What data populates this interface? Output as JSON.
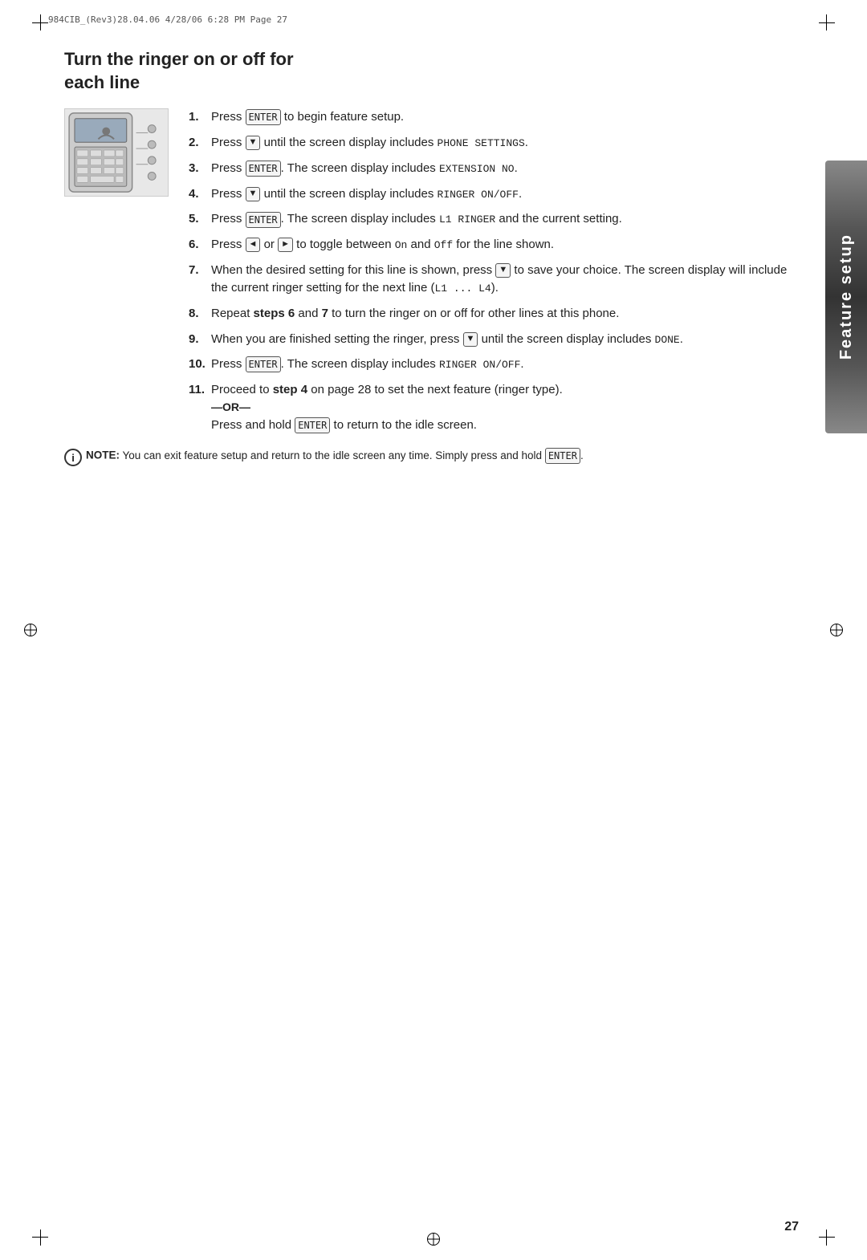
{
  "header": {
    "label": "984CIB_(Rev3)28.04.06  4/28/06  6:28 PM  Page 27"
  },
  "sidebar": {
    "text": "Feature setup"
  },
  "title": {
    "line1": "Turn the ringer on or off for",
    "line2": "each line"
  },
  "steps": [
    {
      "num": "1.",
      "text_parts": [
        {
          "type": "text",
          "value": "Press "
        },
        {
          "type": "key",
          "value": "ENTER"
        },
        {
          "type": "text",
          "value": " to begin feature setup."
        }
      ]
    },
    {
      "num": "2.",
      "text_parts": [
        {
          "type": "text",
          "value": "Press "
        },
        {
          "type": "arrow",
          "value": "▼"
        },
        {
          "type": "text",
          "value": " until the screen display includes "
        },
        {
          "type": "mono",
          "value": "PHONE SETTINGS"
        },
        {
          "type": "text",
          "value": "."
        }
      ]
    },
    {
      "num": "3.",
      "text_parts": [
        {
          "type": "text",
          "value": "Press "
        },
        {
          "type": "key",
          "value": "ENTER"
        },
        {
          "type": "text",
          "value": ". The screen display includes "
        },
        {
          "type": "mono",
          "value": "EXTENSION NO"
        },
        {
          "type": "text",
          "value": "."
        }
      ]
    },
    {
      "num": "4.",
      "text_parts": [
        {
          "type": "text",
          "value": "Press "
        },
        {
          "type": "arrow",
          "value": "▼"
        },
        {
          "type": "text",
          "value": " until the screen display includes "
        },
        {
          "type": "mono",
          "value": "RINGER ON/OFF"
        },
        {
          "type": "text",
          "value": "."
        }
      ]
    },
    {
      "num": "5.",
      "text_parts": [
        {
          "type": "text",
          "value": "Press "
        },
        {
          "type": "key",
          "value": "ENTER"
        },
        {
          "type": "text",
          "value": ". The screen display includes "
        },
        {
          "type": "mono",
          "value": "L1 RINGER"
        },
        {
          "type": "text",
          "value": " and the current setting."
        }
      ]
    },
    {
      "num": "6.",
      "text_parts": [
        {
          "type": "text",
          "value": "Press "
        },
        {
          "type": "arrow",
          "value": "◄"
        },
        {
          "type": "text",
          "value": " or "
        },
        {
          "type": "arrow",
          "value": "►"
        },
        {
          "type": "text",
          "value": " to toggle between "
        },
        {
          "type": "mono",
          "value": "On"
        },
        {
          "type": "text",
          "value": " and "
        },
        {
          "type": "mono",
          "value": "Off"
        },
        {
          "type": "text",
          "value": " for the line shown."
        }
      ]
    },
    {
      "num": "7.",
      "text_parts": [
        {
          "type": "text",
          "value": "When the desired setting for this line is shown, press "
        },
        {
          "type": "arrow",
          "value": "▼"
        },
        {
          "type": "text",
          "value": " to save your choice.  The screen display will include the current ringer setting for the next line ("
        },
        {
          "type": "mono",
          "value": "L1  ...  L4"
        },
        {
          "type": "text",
          "value": ")."
        }
      ]
    },
    {
      "num": "8.",
      "text_parts": [
        {
          "type": "text",
          "value": "Repeat "
        },
        {
          "type": "bold",
          "value": "steps 6"
        },
        {
          "type": "text",
          "value": " and "
        },
        {
          "type": "bold",
          "value": "7"
        },
        {
          "type": "text",
          "value": " to turn the ringer on or off for other lines at this phone."
        }
      ]
    },
    {
      "num": "9.",
      "text_parts": [
        {
          "type": "text",
          "value": "When you are finished setting the ringer,  press "
        },
        {
          "type": "arrow",
          "value": "▼"
        },
        {
          "type": "text",
          "value": " until the screen display includes "
        },
        {
          "type": "mono",
          "value": "DONE"
        },
        {
          "type": "text",
          "value": "."
        }
      ]
    },
    {
      "num": "10.",
      "text_parts": [
        {
          "type": "text",
          "value": "Press "
        },
        {
          "type": "key",
          "value": "ENTER"
        },
        {
          "type": "text",
          "value": ". The screen display includes "
        },
        {
          "type": "mono",
          "value": "RINGER ON/OFF"
        },
        {
          "type": "text",
          "value": "."
        }
      ]
    },
    {
      "num": "11.",
      "text_parts": [
        {
          "type": "text",
          "value": "Proceed to "
        },
        {
          "type": "bold",
          "value": "step 4"
        },
        {
          "type": "text",
          "value": " on page 28 to set the next feature (ringer type)."
        }
      ],
      "or_section": {
        "divider": "—OR—",
        "text_parts": [
          {
            "type": "text",
            "value": "Press and hold "
          },
          {
            "type": "key",
            "value": "ENTER"
          },
          {
            "type": "text",
            "value": " to return to the idle screen."
          }
        ]
      }
    }
  ],
  "note": {
    "label": "NOTE:",
    "text": " You can exit feature setup and return to the idle screen any time.  Simply press and hold ",
    "key": "ENTER",
    "end": "."
  },
  "page_number": "27"
}
